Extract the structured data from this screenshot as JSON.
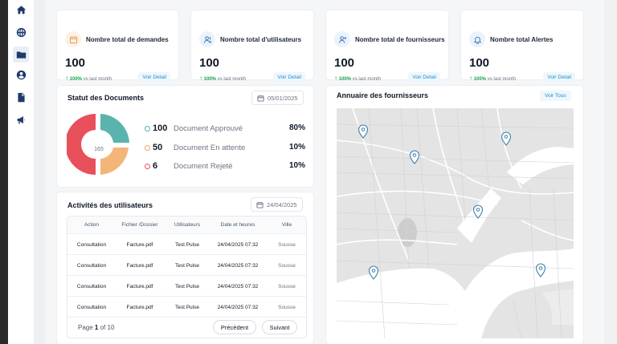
{
  "sidebar": {
    "items": [
      {
        "icon": "home-icon"
      },
      {
        "icon": "globe-icon"
      },
      {
        "icon": "folder-icon",
        "active": true
      },
      {
        "icon": "user-icon"
      },
      {
        "icon": "document-icon"
      },
      {
        "icon": "megaphone-icon"
      }
    ]
  },
  "stats": [
    {
      "title": "Nombre total de demandes",
      "value": "100",
      "trend_pct": "100%",
      "trend_text": "vs last month",
      "button": "Voir Detail",
      "icon": "calendar-icon",
      "icon_bg": "#fdf1e6",
      "icon_color": "#e9964a"
    },
    {
      "title": "Nombre total d'utilisateurs",
      "value": "100",
      "trend_pct": "100%",
      "trend_text": "vs last month",
      "button": "Voir Detail",
      "icon": "users-icon",
      "icon_bg": "#eaf3fb",
      "icon_color": "#2f6fa8"
    },
    {
      "title": "Nombre total de fournisseurs",
      "value": "100",
      "trend_pct": "100%",
      "trend_text": "vs last month",
      "button": "Voir Detail",
      "icon": "user-plus-icon",
      "icon_bg": "#eaf3fb",
      "icon_color": "#2f6fa8"
    },
    {
      "title": "Nombre total Alertes",
      "value": "100",
      "trend_pct": "100%",
      "trend_text": "vs last month",
      "button": "Voir Detail",
      "icon": "bell-icon",
      "icon_bg": "#eaf3fb",
      "icon_color": "#2f6fa8"
    }
  ],
  "documents": {
    "title": "Statut des Documents",
    "date": "05/01/2025",
    "donut_center": "165",
    "legend": [
      {
        "count": "100",
        "label": "Document Approuvé",
        "pct": "80%",
        "color": "#5bb3ad"
      },
      {
        "count": "50",
        "label": "Document En attente",
        "pct": "10%",
        "color": "#f4a95a"
      },
      {
        "count": "6",
        "label": "Document Rejeté",
        "pct": "10%",
        "color": "#e8505b"
      }
    ]
  },
  "activities": {
    "title": "Activités des utilisateurs",
    "date": "24/04/2025",
    "columns": [
      "Action",
      "Fichier /Dossier",
      "Utilisateurs",
      "Date et heures",
      "Ville"
    ],
    "rows": [
      [
        "Consultation",
        "Facture.pdf",
        "Test Pulse",
        "24/04/2025 07:32",
        "Sousse"
      ],
      [
        "Consultation",
        "Facture.pdf",
        "Test Pulse",
        "24/04/2025 07:32",
        "Sousse"
      ],
      [
        "Consultation",
        "Facture.pdf",
        "Test Pulse",
        "24/04/2025 07:32",
        "Sousse"
      ],
      [
        "Consultation",
        "Facture.pdf",
        "Test Pulse",
        "24/04/2025 07:32",
        "Sousse"
      ]
    ],
    "page_prefix": "Page",
    "page_current": "1",
    "page_of": "of",
    "page_total": "10",
    "prev": "Précédent",
    "next": "Suivant"
  },
  "suppliers": {
    "title": "Annuaire des fournisseurs",
    "button": "Voir Tous",
    "pin_icon": "map-pin-icon",
    "pin_color": "#3d7fa8"
  }
}
